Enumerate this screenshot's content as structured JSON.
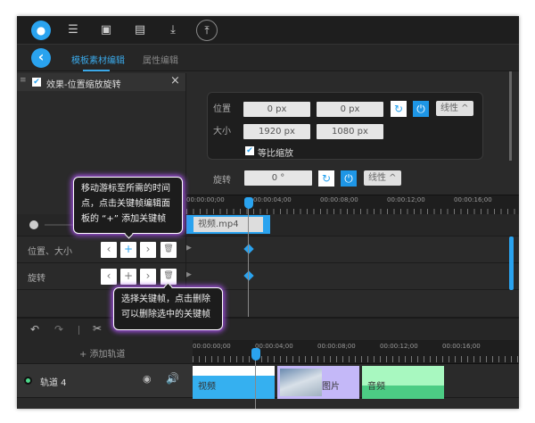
{
  "toolbar": {
    "icons": [
      "app-logo",
      "list-icon",
      "layout-icon",
      "layers-icon",
      "download-icon",
      "upload-icon"
    ]
  },
  "tabs": {
    "back": "‹",
    "items": [
      {
        "label": "模板素材编辑",
        "active": true
      },
      {
        "label": "属性编辑",
        "active": false
      }
    ]
  },
  "effect_panel": {
    "title": "效果-位置缩放旋转",
    "checked": true,
    "close": "×"
  },
  "properties": {
    "position_label": "位置",
    "pos_x": "0 px",
    "pos_y": "0 px",
    "size_label": "大小",
    "width": "1920 px",
    "height": "1080 px",
    "proportional_label": "等比缩放",
    "proportional_checked": true,
    "rotate_label": "旋转",
    "rotate": "0 °",
    "easing": "线性 ^"
  },
  "keyframe_timeline": {
    "ticks": [
      "00:00:00;00",
      "00:00:04;00",
      "00:00:08;00",
      "00:00:12;00",
      "00:00:16;00"
    ],
    "clip": "视频.mp4",
    "rows": [
      "位置、大小",
      "旋转"
    ]
  },
  "tooltips": {
    "add": "移动游标至所需的时间点，点击关键帧编辑面板的 “+” 添加关键帧",
    "delete": "选择关键帧，点击删除可以删除选中的关键帧"
  },
  "main_timeline": {
    "add_track": "+ 添加轨道",
    "ticks": [
      "00:00:00;00",
      "00:00:04;00",
      "00:00:08;00",
      "00:00:12;00",
      "00:00:16;00"
    ],
    "track_name": "轨道 4",
    "clips": [
      {
        "label": "视频",
        "color": "#35b0f0"
      },
      {
        "label": "图片",
        "color": "#c4b8f8"
      },
      {
        "label": "音频",
        "color": "#a8f8c0"
      }
    ]
  },
  "colors": {
    "accent": "#1e96e6",
    "tooltip_glow": "#a050e0"
  }
}
